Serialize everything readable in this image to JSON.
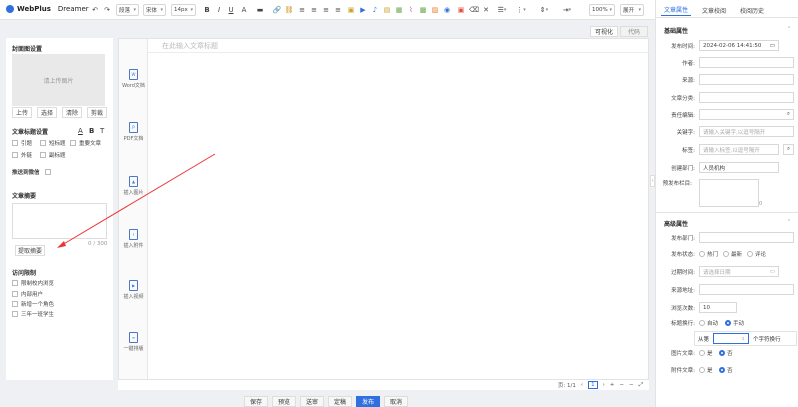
{
  "brand": {
    "name": "WebPlus",
    "product": "Dreamer"
  },
  "toolbar": {
    "paragraph": "段落",
    "font": "宋体",
    "size": "14px",
    "bold": "B",
    "italic": "I",
    "underline": "U",
    "zoom": "100%",
    "expand": "展开"
  },
  "left": {
    "cover_title": "封面图设置",
    "cover_placeholder": "请上传图片",
    "cover_buttons": [
      "上传",
      "选择",
      "清除",
      "剪裁"
    ],
    "title_settings": "文章标题设置",
    "title_icons": [
      "A",
      "B",
      "T"
    ],
    "title_options": [
      "引题",
      "短标题",
      "重要文章",
      "外链",
      "副标题"
    ],
    "push_wechat": "推送到微信",
    "summary_title": "文章摘要",
    "summary_count": "0 / 300",
    "extract_button": "提取摘要",
    "access_title": "访问限制",
    "access_options": [
      "限制校内浏览",
      "内部用户",
      "新增一个角色",
      "三年一班学生"
    ]
  },
  "editor": {
    "title_placeholder": "在此输入文章标题",
    "view_tabs": [
      "可视化",
      "代码"
    ],
    "tools": [
      "Word文档",
      "PDF文档",
      "插入图片",
      "插入附件",
      "插入视频",
      "一键排版"
    ],
    "page_label": "页: 1/1",
    "page_num": "1"
  },
  "actions": [
    "保存",
    "预览",
    "送审",
    "定稿",
    "发布",
    "取消"
  ],
  "right": {
    "tabs": [
      "文章属性",
      "文章校阅",
      "校阅历史"
    ],
    "basic_title": "基础属性",
    "publish_time_label": "发布时间:",
    "publish_time": "2024-02-06 14:41:50",
    "author_label": "作者:",
    "source_label": "来源:",
    "category_label": "文章分类:",
    "editor_label": "责任编辑:",
    "keyword_label": "关键字:",
    "keyword_placeholder": "请输入关键字,以逗号隔开",
    "tag_label": "标签:",
    "tag_placeholder": "请输入标签,以逗号隔开",
    "dept_label": "创建部门:",
    "dept_value": "人员机构",
    "column_label": "预发布栏目:",
    "column_count": "0",
    "advanced_title": "高级属性",
    "pub_dept_label": "发布部门:",
    "pub_status_label": "发布状态:",
    "pub_status_options": [
      "热门",
      "最新",
      "评论"
    ],
    "expire_label": "过期时间:",
    "expire_placeholder": "请选择日期",
    "source_url_label": "来源地址:",
    "views_label": "浏览次数:",
    "views_value": "10",
    "wrap_label": "标题换行:",
    "wrap_options": [
      "自动",
      "手动"
    ],
    "wrap_from": "从第",
    "wrap_suffix": "个字符换行",
    "image_label": "图片文章:",
    "attach_label": "附件文章:",
    "yes": "是",
    "no": "否"
  }
}
